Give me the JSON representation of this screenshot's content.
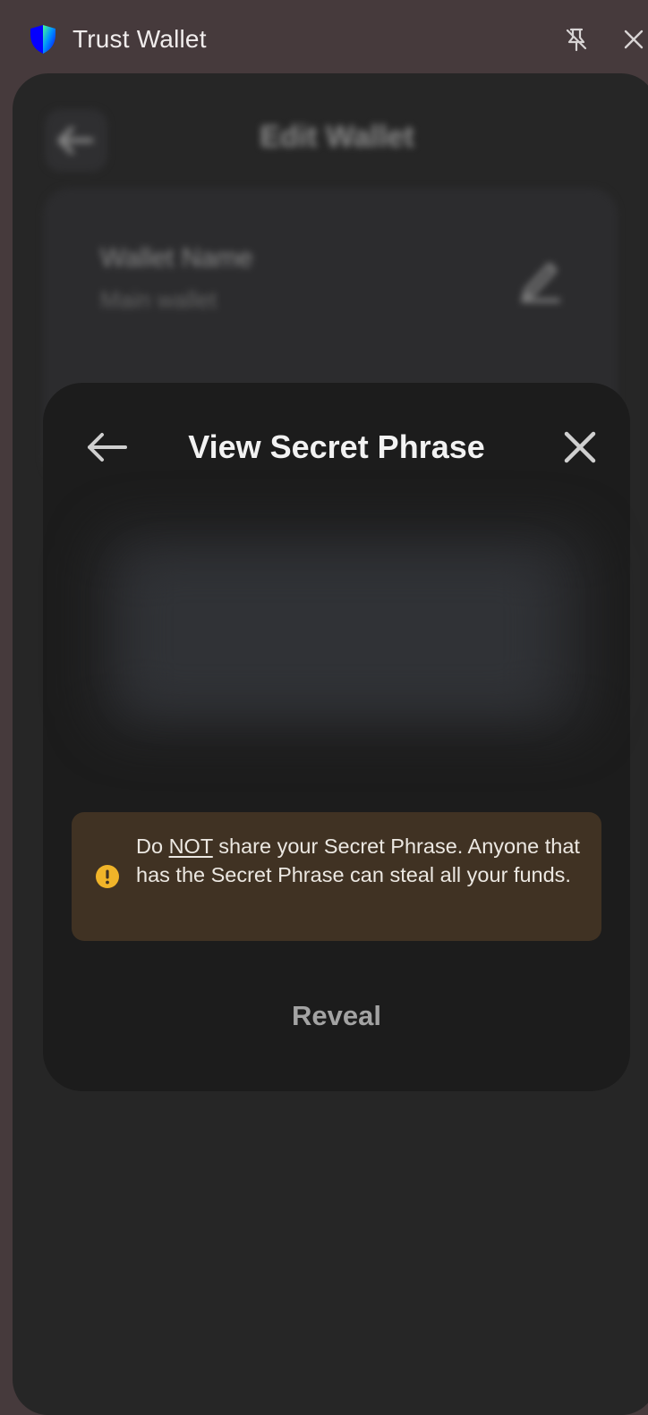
{
  "window": {
    "title": "Trust Wallet",
    "logo_icon": "trust-wallet-shield-icon",
    "pin_icon": "unpin-icon",
    "close_icon": "close-icon"
  },
  "background": {
    "page_title": "Edit Wallet",
    "back_icon": "arrow-left-icon",
    "wallet_name_label": "Wallet Name",
    "wallet_name_value": "Main wallet",
    "edit_icon": "pencil-icon"
  },
  "modal": {
    "title": "View Secret Phrase",
    "back_icon": "arrow-left-icon",
    "close_icon": "close-icon",
    "warning": {
      "icon": "exclamation-circle-icon",
      "prefix": "Do ",
      "emphasis": "NOT",
      "suffix": " share your Secret Phrase. Anyone that has the Secret Phrase can steal all your funds."
    },
    "reveal_label": "Reveal"
  },
  "colors": {
    "window_bg": "#463a3c",
    "panel_bg": "#262626",
    "modal_bg": "#1c1c1c",
    "warning_bg": "#403223",
    "warning_icon": "#f0b429",
    "shield_blue": "#0500ff"
  }
}
